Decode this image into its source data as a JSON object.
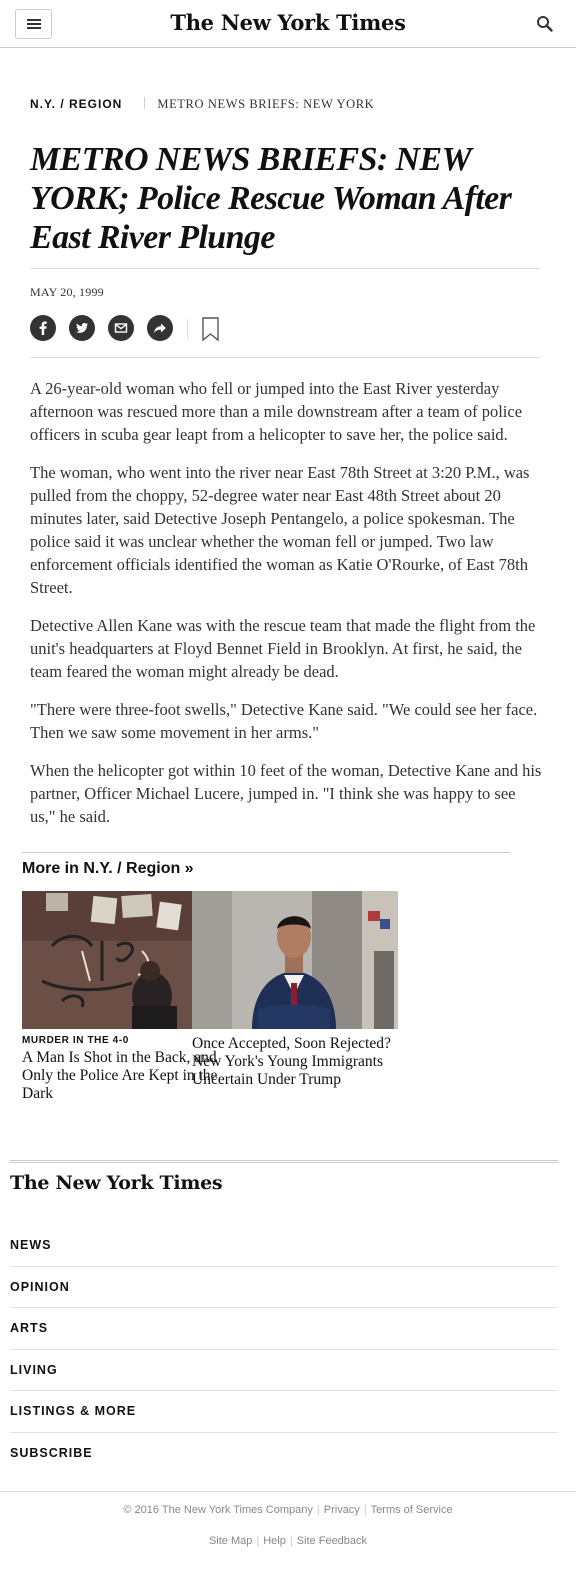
{
  "header": {
    "logo": "The New York Times",
    "menu_icon": "hamburger-icon",
    "search_icon": "search-icon"
  },
  "article": {
    "section": "N.Y. / REGION",
    "column": "METRO NEWS BRIEFS: NEW YORK",
    "headline": "METRO NEWS BRIEFS: NEW YORK; Police Rescue Woman After East River Plunge",
    "date": "MAY 20, 1999",
    "share_icons": [
      "facebook-icon",
      "twitter-icon",
      "email-icon",
      "share-icon",
      "bookmark-icon"
    ],
    "paragraphs": [
      "A 26-year-old woman who fell or jumped into the East River yesterday afternoon was rescued more than a mile downstream after a team of police officers in scuba gear leapt from a helicopter to save her, the police said.",
      "The woman, who went into the river near East 78th Street at 3:20 P.M., was pulled from the choppy, 52-degree water near East 48th Street about 20 minutes later, said Detective Joseph Pentangelo, a police spokesman. The police said it was unclear whether the woman fell or jumped. Two law enforcement officials identified the woman as Katie O'Rourke, of East 78th Street.",
      "Detective Allen Kane was with the rescue team that made the flight from the unit's headquarters at Floyd Bennet Field in Brooklyn. At first, he said, the team feared the woman might already be dead.",
      "\"There were three-foot swells,\" Detective Kane said. \"We could see her face. Then we saw some movement in her arms.\"",
      "When the helicopter got within 10 feet of the woman, Detective Kane and his partner, Officer Michael Lucere, jumped in. \"I think she was happy to see us,\" he said."
    ]
  },
  "more": {
    "title": "More in N.Y. / Region »",
    "items": [
      {
        "label": "MURDER IN THE 4-0",
        "title": "A Man Is Shot in the Back, and Only the Police Are Kept in the Dark"
      },
      {
        "label": "",
        "title": "Once Accepted, Soon Rejected? New York's Young Immigrants Uncertain Under Trump"
      }
    ]
  },
  "footer": {
    "logo": "The New York Times",
    "nav": [
      "NEWS",
      "OPINION",
      "ARTS",
      "LIVING",
      "LISTINGS & MORE",
      "SUBSCRIBE"
    ],
    "copyright": "© 2016 The New York Times Company",
    "privacy": "Privacy",
    "terms": "Terms of Service",
    "site_map": "Site Map",
    "help": "Help",
    "feedback": "Site Feedback"
  }
}
